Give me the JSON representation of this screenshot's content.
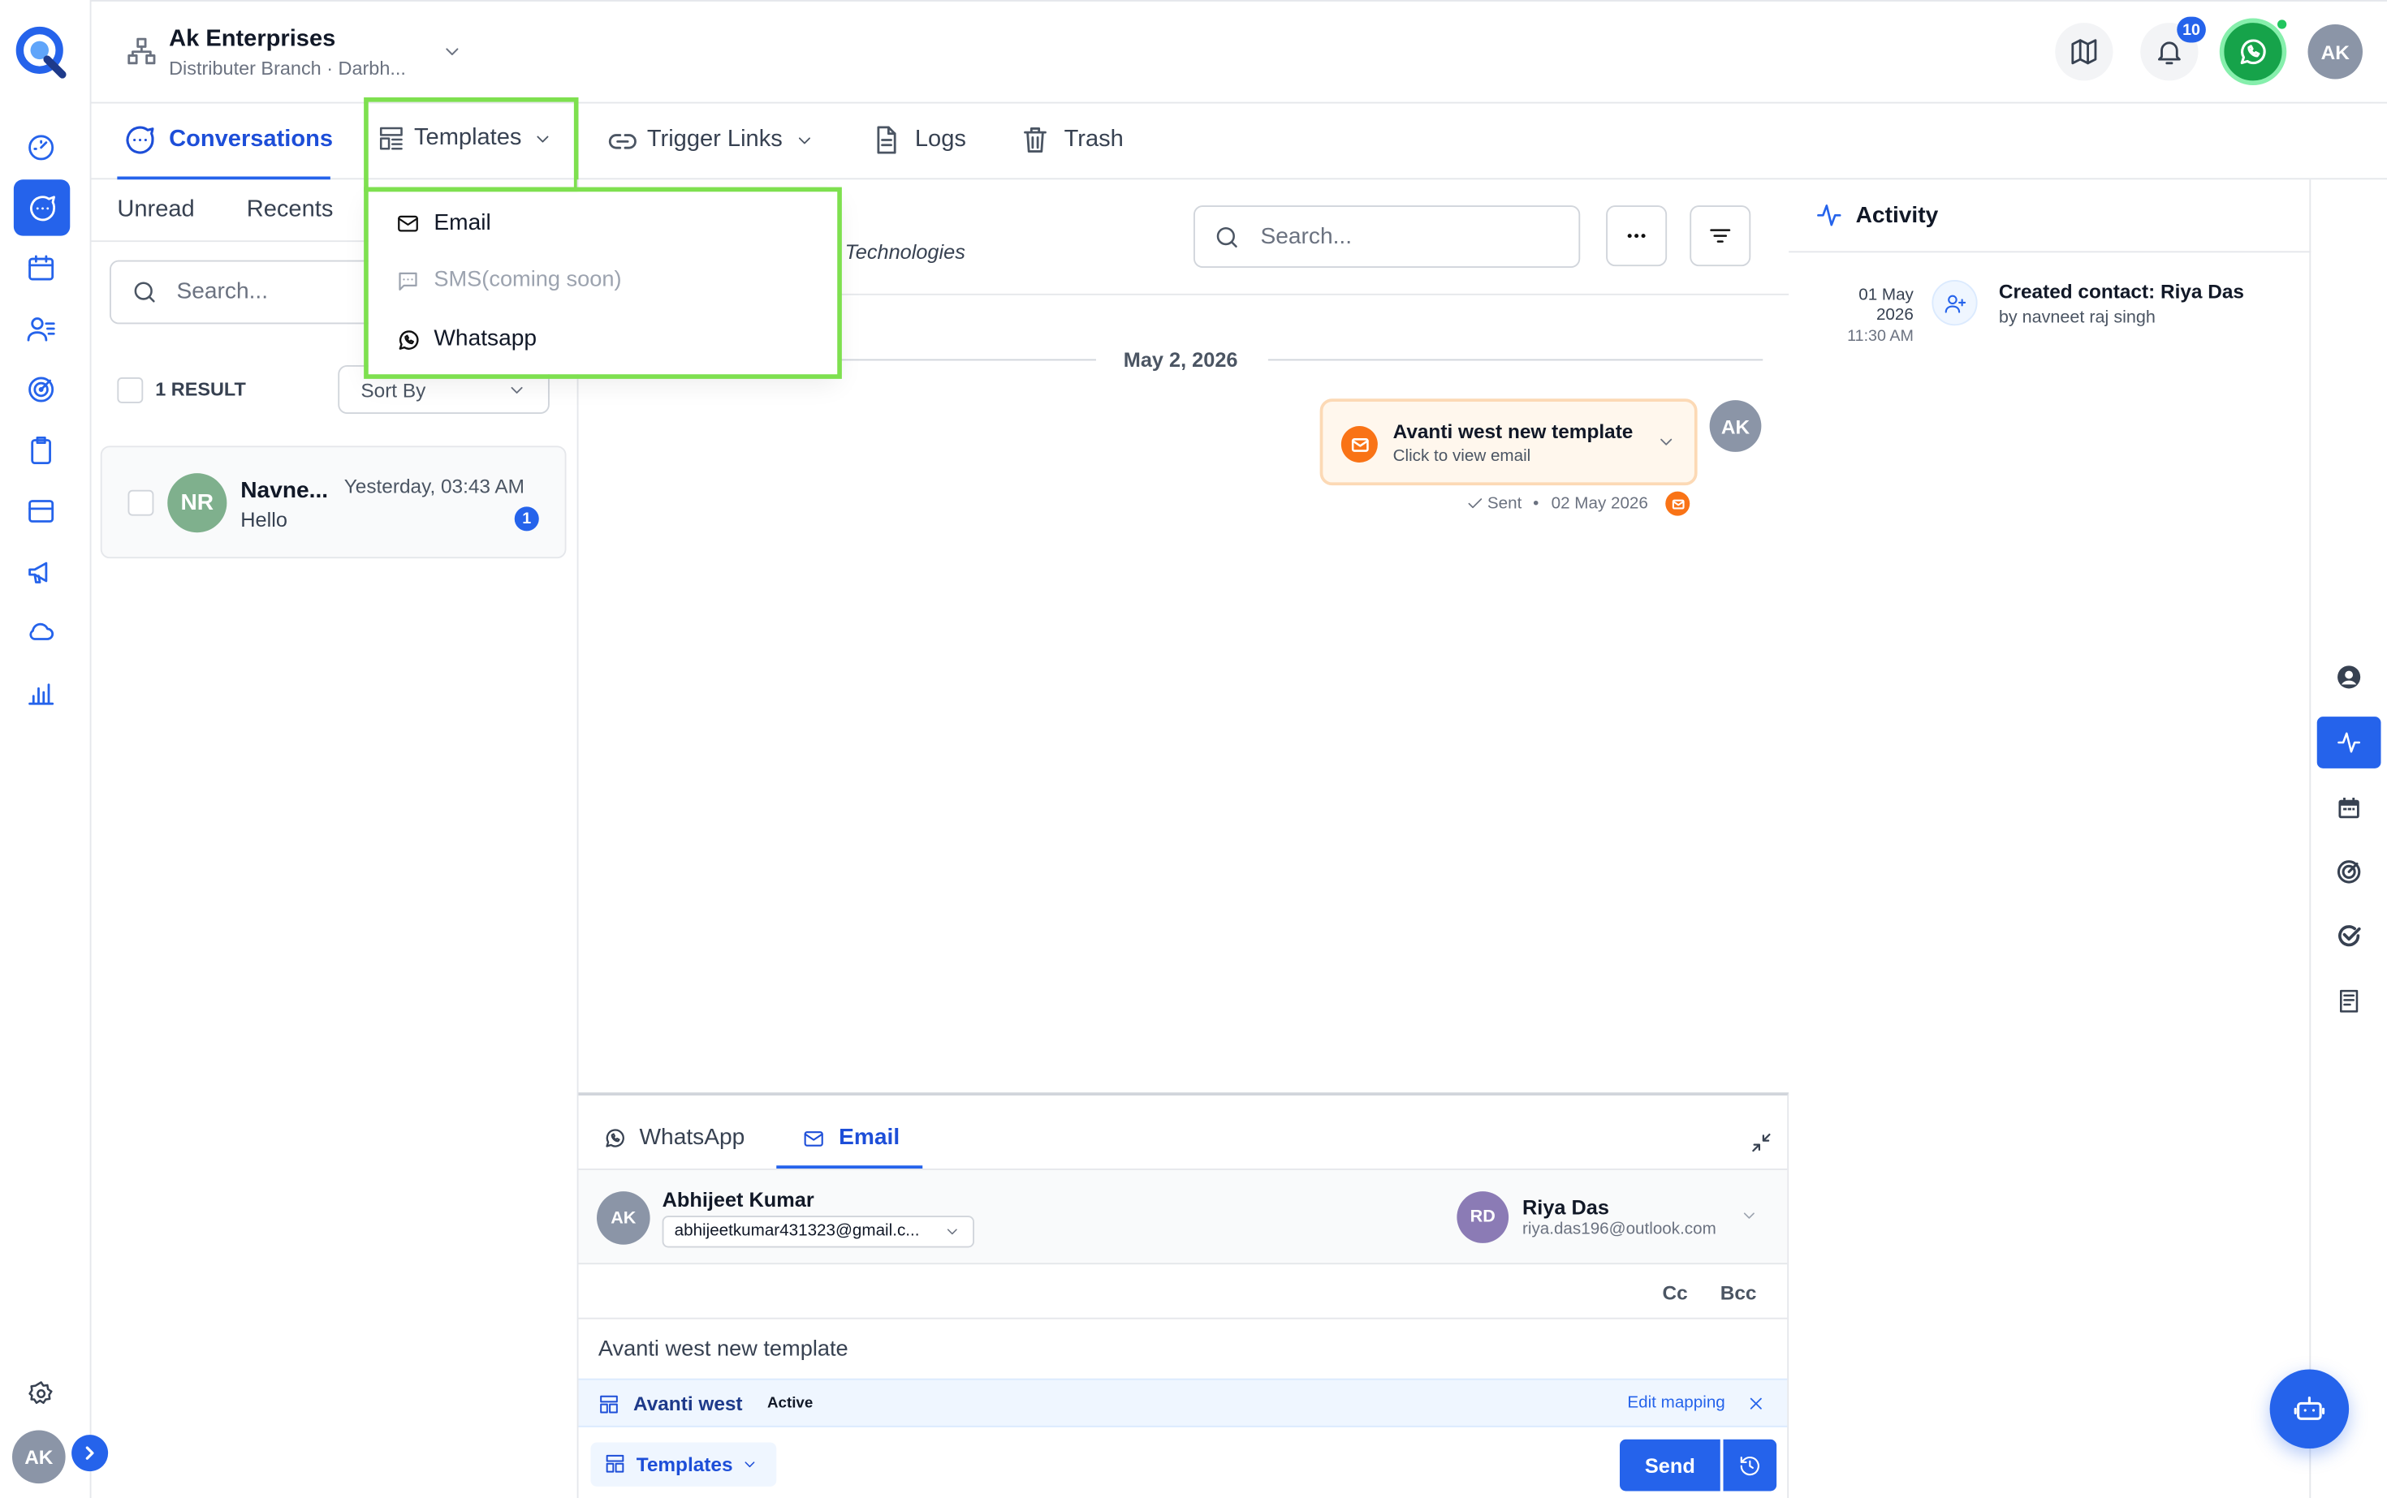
{
  "header": {
    "company_name": "Ak Enterprises",
    "branch": "Distributer Branch · Darbh...",
    "notification_count": "10",
    "user_initials": "AK"
  },
  "tabs": {
    "conversations": "Conversations",
    "templates": "Templates",
    "trigger_links": "Trigger Links",
    "logs": "Logs",
    "trash": "Trash"
  },
  "templates_menu": {
    "email": "Email",
    "sms": "SMS(coming soon)",
    "whatsapp": "Whatsapp"
  },
  "list_panel": {
    "tab_unread": "Unread",
    "tab_recents": "Recents",
    "search_placeholder": "Search...",
    "result_count": "1 RESULT",
    "sort_label": "Sort By",
    "conversation": {
      "initials": "NR",
      "name": "Navne...",
      "time": "Yesterday, 03:43 AM",
      "preview": "Hello",
      "unread": "1"
    }
  },
  "chat": {
    "partial_company": "Technologies",
    "search_placeholder": "Search...",
    "date_divider": "May 2, 2026",
    "message": {
      "title": "Avanti west new template",
      "subtitle": "Click to view email",
      "status": "Sent",
      "date": "02 May 2026",
      "sender_initials": "AK"
    }
  },
  "composer": {
    "tab_whatsapp": "WhatsApp",
    "tab_email": "Email",
    "from_initials": "AK",
    "from_name": "Abhijeet Kumar",
    "from_email": "abhijeetkumar431323@gmail.c...",
    "to_initials": "RD",
    "to_name": "Riya Das",
    "to_email": "riya.das196@outlook.com",
    "cc": "Cc",
    "bcc": "Bcc",
    "subject": "Avanti west new template",
    "template_name": "Avanti west",
    "template_status": "Active",
    "edit_mapping": "Edit mapping",
    "templates_button": "Templates",
    "send_button": "Send"
  },
  "activity": {
    "title": "Activity",
    "entry": {
      "day_month": "01 May",
      "year": "2026",
      "time": "11:30 AM",
      "title": "Created contact: Riya Das",
      "by": "by navneet raj singh"
    }
  },
  "sidebar_footer": {
    "user_initials": "AK"
  },
  "colors": {
    "accent": "#2563eb",
    "highlight": "#7ee04f",
    "whatsapp": "#16a34a",
    "email_orange": "#f97316"
  }
}
